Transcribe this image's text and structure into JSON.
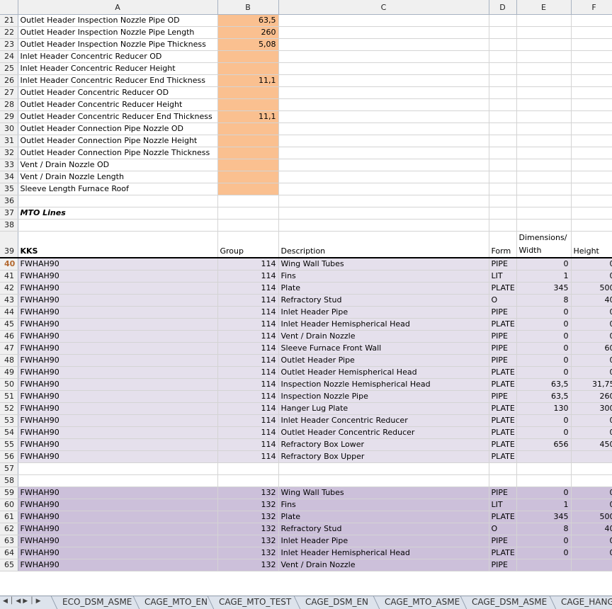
{
  "columns": [
    "A",
    "B",
    "C",
    "D",
    "E",
    "F"
  ],
  "params": [
    {
      "row": "21",
      "label": "Outlet Header Inspection Nozzle Pipe OD",
      "value": "63,5"
    },
    {
      "row": "22",
      "label": "Outlet Header Inspection Nozzle Pipe Length",
      "value": "260"
    },
    {
      "row": "23",
      "label": "Outlet Header Inspection Nozzle Pipe Thickness",
      "value": "5,08"
    },
    {
      "row": "24",
      "label": "Inlet Header Concentric Reducer OD",
      "value": ""
    },
    {
      "row": "25",
      "label": "Inlet Header Concentric Reducer Height",
      "value": ""
    },
    {
      "row": "26",
      "label": "Inlet Header Concentric Reducer End Thickness",
      "value": "11,1"
    },
    {
      "row": "27",
      "label": "Outlet Header Concentric Reducer OD",
      "value": ""
    },
    {
      "row": "28",
      "label": "Outlet Header Concentric Reducer Height",
      "value": ""
    },
    {
      "row": "29",
      "label": "Outlet Header Concentric Reducer End Thickness",
      "value": "11,1"
    },
    {
      "row": "30",
      "label": "Outlet Header Connection Pipe Nozzle OD",
      "value": ""
    },
    {
      "row": "31",
      "label": "Outlet Header Connection Pipe Nozzle Height",
      "value": ""
    },
    {
      "row": "32",
      "label": "Outlet Header Connection Pipe Nozzle Thickness",
      "value": ""
    },
    {
      "row": "33",
      "label": "Vent / Drain Nozzle OD",
      "value": ""
    },
    {
      "row": "34",
      "label": "Vent / Drain Nozzle Length",
      "value": ""
    },
    {
      "row": "35",
      "label": "Sleeve Length Furnace Roof",
      "value": ""
    }
  ],
  "blank_rows": {
    "r36": "36",
    "r38": "38",
    "r57": "57",
    "r58": "58"
  },
  "mto_row": {
    "row": "37",
    "label": "MTO Lines"
  },
  "header_row": {
    "row": "39",
    "kks": "KKS",
    "group": "Group",
    "description": "Description",
    "form": "Form",
    "dim_line1": "Dimensions/",
    "dim_line2": "Width",
    "height": "Height"
  },
  "selected_row": "40",
  "lines1": [
    {
      "row": "40",
      "kks": "FWHAH90",
      "group": "114",
      "desc": "Wing Wall Tubes",
      "form": "PIPE",
      "width": "0",
      "height": "0"
    },
    {
      "row": "41",
      "kks": "FWHAH90",
      "group": "114",
      "desc": "Fins",
      "form": "LIT",
      "width": "1",
      "height": "0"
    },
    {
      "row": "42",
      "kks": "FWHAH90",
      "group": "114",
      "desc": "Plate",
      "form": "PLATE",
      "width": "345",
      "height": "500"
    },
    {
      "row": "43",
      "kks": "FWHAH90",
      "group": "114",
      "desc": "Refractory Stud",
      "form": "O",
      "width": "8",
      "height": "40"
    },
    {
      "row": "44",
      "kks": "FWHAH90",
      "group": "114",
      "desc": "Inlet Header Pipe",
      "form": "PIPE",
      "width": "0",
      "height": "0"
    },
    {
      "row": "45",
      "kks": "FWHAH90",
      "group": "114",
      "desc": "Inlet Header Hemispherical Head",
      "form": "PLATE",
      "width": "0",
      "height": "0"
    },
    {
      "row": "46",
      "kks": "FWHAH90",
      "group": "114",
      "desc": "Vent / Drain Nozzle",
      "form": "PIPE",
      "width": "0",
      "height": "0"
    },
    {
      "row": "47",
      "kks": "FWHAH90",
      "group": "114",
      "desc": "Sleeve Furnace Front Wall",
      "form": "PIPE",
      "width": "0",
      "height": "60"
    },
    {
      "row": "48",
      "kks": "FWHAH90",
      "group": "114",
      "desc": "Outlet Header Pipe",
      "form": "PIPE",
      "width": "0",
      "height": "0"
    },
    {
      "row": "49",
      "kks": "FWHAH90",
      "group": "114",
      "desc": "Outlet Header Hemispherical Head",
      "form": "PLATE",
      "width": "0",
      "height": "0"
    },
    {
      "row": "50",
      "kks": "FWHAH90",
      "group": "114",
      "desc": "Inspection Nozzle Hemispherical Head",
      "form": "PLATE",
      "width": "63,5",
      "height": "31,75"
    },
    {
      "row": "51",
      "kks": "FWHAH90",
      "group": "114",
      "desc": "Inspection Nozzle Pipe",
      "form": "PIPE",
      "width": "63,5",
      "height": "260"
    },
    {
      "row": "52",
      "kks": "FWHAH90",
      "group": "114",
      "desc": "Hanger Lug Plate",
      "form": "PLATE",
      "width": "130",
      "height": "300"
    },
    {
      "row": "53",
      "kks": "FWHAH90",
      "group": "114",
      "desc": "Inlet Header Concentric Reducer",
      "form": "PLATE",
      "width": "0",
      "height": "0"
    },
    {
      "row": "54",
      "kks": "FWHAH90",
      "group": "114",
      "desc": "Outlet Header Concentric Reducer",
      "form": "PLATE",
      "width": "0",
      "height": "0"
    },
    {
      "row": "55",
      "kks": "FWHAH90",
      "group": "114",
      "desc": "Refractory Box Lower",
      "form": "PLATE",
      "width": "656",
      "height": "450"
    },
    {
      "row": "56",
      "kks": "FWHAH90",
      "group": "114",
      "desc": "Refractory Box Upper",
      "form": "PLATE",
      "width": "",
      "height": ""
    }
  ],
  "lines2": [
    {
      "row": "59",
      "kks": "FWHAH90",
      "group": "132",
      "desc": "Wing Wall Tubes",
      "form": "PIPE",
      "width": "0",
      "height": "0"
    },
    {
      "row": "60",
      "kks": "FWHAH90",
      "group": "132",
      "desc": "Fins",
      "form": "LIT",
      "width": "1",
      "height": "0"
    },
    {
      "row": "61",
      "kks": "FWHAH90",
      "group": "132",
      "desc": "Plate",
      "form": "PLATE",
      "width": "345",
      "height": "500"
    },
    {
      "row": "62",
      "kks": "FWHAH90",
      "group": "132",
      "desc": "Refractory Stud",
      "form": "O",
      "width": "8",
      "height": "40"
    },
    {
      "row": "63",
      "kks": "FWHAH90",
      "group": "132",
      "desc": "Inlet Header Pipe",
      "form": "PIPE",
      "width": "0",
      "height": "0"
    },
    {
      "row": "64",
      "kks": "FWHAH90",
      "group": "132",
      "desc": "Inlet Header Hemispherical Head",
      "form": "PLATE",
      "width": "0",
      "height": "0"
    },
    {
      "row": "65",
      "kks": "FWHAH90",
      "group": "132",
      "desc": "Vent / Drain Nozzle",
      "form": "PIPE",
      "width": "",
      "height": ""
    }
  ],
  "tabs": [
    "ECO_DSM_ASME",
    "CAGE_MTO_EN",
    "CAGE_MTO_TEST",
    "CAGE_DSM_EN",
    "CAGE_MTO_ASME",
    "CAGE_DSM_ASME",
    "CAGE_HANGE"
  ],
  "icons": {
    "first": "first-sheet-icon",
    "prev": "prev-sheet-icon",
    "next": "next-sheet-icon",
    "last": "last-sheet-icon"
  }
}
